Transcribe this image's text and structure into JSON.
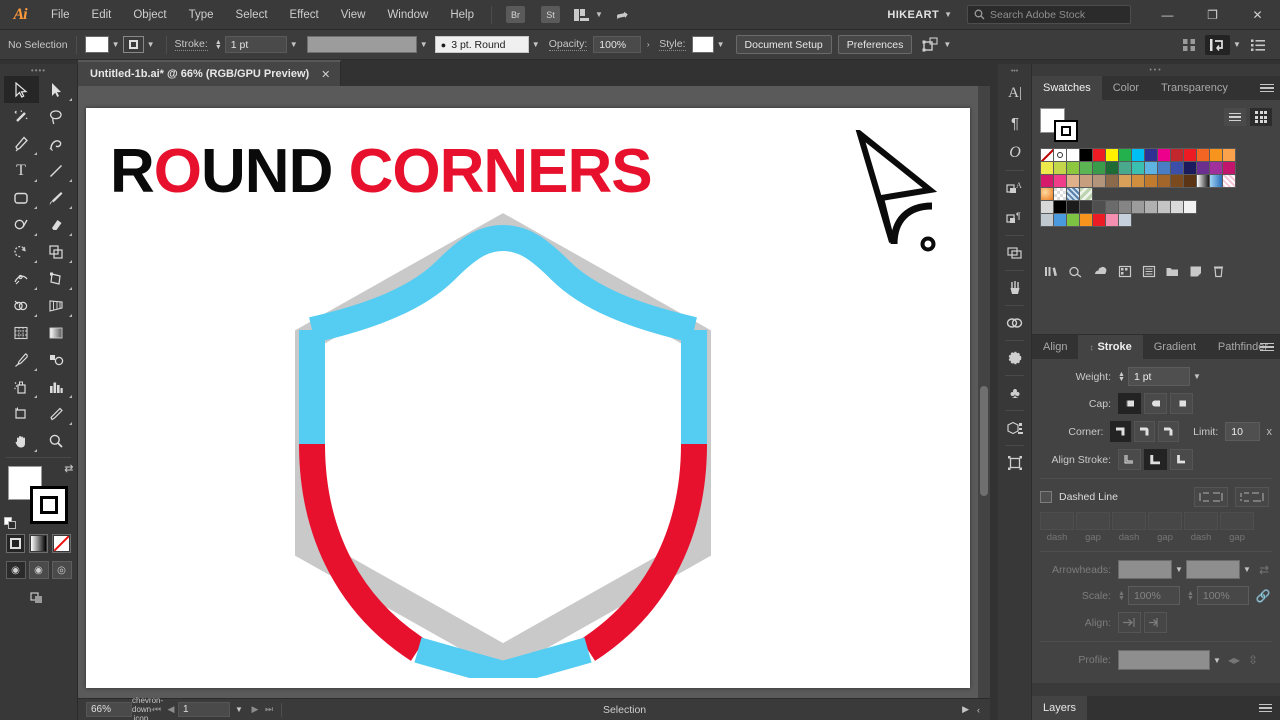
{
  "app": {
    "logo": "Ai",
    "user": "HIKEART"
  },
  "menubar": {
    "items": [
      "File",
      "Edit",
      "Object",
      "Type",
      "Select",
      "Effect",
      "View",
      "Window",
      "Help"
    ],
    "bridge_label": "Br",
    "stock_label": "St",
    "arrange_icon": "arrange-documents-icon",
    "rocket_icon": "rocket-icon",
    "user_chevron": "chevron-down-icon",
    "search_placeholder": "Search Adobe Stock",
    "search_icon": "search-icon",
    "window_buttons": {
      "minimize": "—",
      "maximize": "❐",
      "close": "✕"
    }
  },
  "controlbar": {
    "selection_status": "No Selection",
    "fill_color": "#ffffff",
    "stroke_color": "#ffffff",
    "stroke_label": "Stroke:",
    "stroke_weight": "1 pt",
    "brush_definition": "3 pt. Round",
    "opacity_label": "Opacity:",
    "opacity_value": "100%",
    "opacity_more": "›",
    "style_label": "Style:",
    "document_setup": "Document Setup",
    "preferences": "Preferences",
    "align_icon": "align-objects-icon",
    "transform_icon": "transform-icon",
    "arrange_icon": "arrange-icon",
    "options_icon": "panel-options-icon"
  },
  "tab": {
    "title": "Untitled-1b.ai* @ 66% (RGB/GPU Preview)",
    "close": "✕"
  },
  "toolbar": {
    "tools": [
      {
        "name": "selection-tool",
        "glyph": "selection",
        "active": true
      },
      {
        "name": "direct-selection-tool",
        "glyph": "direct-selection",
        "active": false
      },
      {
        "name": "magic-wand-tool",
        "glyph": "magic-wand",
        "active": false
      },
      {
        "name": "lasso-tool",
        "glyph": "lasso",
        "active": false
      },
      {
        "name": "pen-tool",
        "glyph": "pen",
        "active": false
      },
      {
        "name": "curvature-tool",
        "glyph": "curvature",
        "active": false
      },
      {
        "name": "type-tool",
        "glyph": "type",
        "active": false
      },
      {
        "name": "line-segment-tool",
        "glyph": "line",
        "active": false
      },
      {
        "name": "rectangle-tool",
        "glyph": "rectangle",
        "active": false
      },
      {
        "name": "paintbrush-tool",
        "glyph": "paintbrush",
        "active": false
      },
      {
        "name": "shaper-tool",
        "glyph": "shaper",
        "active": false
      },
      {
        "name": "eraser-tool",
        "glyph": "eraser",
        "active": false
      },
      {
        "name": "rotate-tool",
        "glyph": "rotate",
        "active": false
      },
      {
        "name": "scale-tool",
        "glyph": "scale",
        "active": false
      },
      {
        "name": "width-tool",
        "glyph": "width",
        "active": false
      },
      {
        "name": "free-transform-tool",
        "glyph": "free-transform",
        "active": false
      },
      {
        "name": "shape-builder-tool",
        "glyph": "shape-builder",
        "active": false
      },
      {
        "name": "perspective-grid-tool",
        "glyph": "perspective",
        "active": false
      },
      {
        "name": "mesh-tool",
        "glyph": "mesh",
        "active": false
      },
      {
        "name": "gradient-tool",
        "glyph": "gradient",
        "active": false
      },
      {
        "name": "eyedropper-tool",
        "glyph": "eyedropper",
        "active": false
      },
      {
        "name": "blend-tool",
        "glyph": "blend",
        "active": false
      },
      {
        "name": "symbol-sprayer-tool",
        "glyph": "symbol-sprayer",
        "active": false
      },
      {
        "name": "column-graph-tool",
        "glyph": "column-graph",
        "active": false
      },
      {
        "name": "artboard-tool",
        "glyph": "artboard",
        "active": false
      },
      {
        "name": "slice-tool",
        "glyph": "slice",
        "active": false
      },
      {
        "name": "hand-tool",
        "glyph": "hand",
        "active": false
      },
      {
        "name": "zoom-tool",
        "glyph": "zoom",
        "active": false
      }
    ],
    "fill_color": "#ffffff",
    "stroke_color": "#000000",
    "swap_icon": "swap-fill-stroke-icon",
    "default_icon": "default-fill-stroke-icon",
    "modes": [
      "color-mode",
      "gradient-mode",
      "none-mode"
    ],
    "screen_modes": [
      "normal-screen-mode",
      "full-screen-menu-mode",
      "full-screen-mode"
    ]
  },
  "artwork": {
    "title_parts": [
      {
        "text": "R",
        "color": "#0a0a0a"
      },
      {
        "text": "O",
        "color": "#e8112d"
      },
      {
        "text": "UND",
        "color": "#0a0a0a"
      },
      {
        "text": " ",
        "color": "#0a0a0a"
      },
      {
        "text": "CORNERS",
        "color": "#e8112d"
      }
    ],
    "shield": {
      "hexagon_color": "#c9c9c9",
      "cyan_color": "#55ccf2",
      "red_color": "#e8112d",
      "description": "shield-outline-over-hexagon"
    },
    "corner_widget": "live-corner-widget-icon"
  },
  "statusbar": {
    "zoom": "66%",
    "zoom_chevron": "chevron-down-icon",
    "artboard_number": "1",
    "artboard_chevron": "chevron-down-icon",
    "nav_first": "❘◀",
    "nav_prev": "◀",
    "nav_next": "▶",
    "nav_last": "▶❘",
    "status_text": "Selection",
    "play_icon": "▶",
    "resize_icon": "‹"
  },
  "icondock": {
    "icons": [
      {
        "name": "character-panel-icon",
        "glyph": "A"
      },
      {
        "name": "paragraph-panel-icon",
        "glyph": "¶"
      },
      {
        "name": "opentype-panel-icon",
        "glyph": "O"
      },
      {
        "name": "appearance-panel-icon",
        "glyph": "❑A"
      },
      {
        "name": "graphic-styles-panel-icon",
        "glyph": "❑¶"
      },
      {
        "name": "layers-panel-icon",
        "glyph": "❐"
      },
      {
        "name": "brushes-panel-icon",
        "glyph": "brush"
      },
      {
        "name": "libraries-panel-icon",
        "glyph": "∞"
      },
      {
        "name": "image-trace-panel-icon",
        "glyph": "◌"
      },
      {
        "name": "symbols-panel-icon",
        "glyph": "♣"
      },
      {
        "name": "asset-export-panel-icon",
        "glyph": "cube"
      },
      {
        "name": "artboards-panel-icon",
        "glyph": "⬚"
      }
    ]
  },
  "swatches": {
    "tabs": [
      {
        "label": "Swatches",
        "active": true
      },
      {
        "label": "Color",
        "active": false
      },
      {
        "label": "Transparency",
        "active": false
      }
    ],
    "menu_icon": "panel-menu-icon",
    "view_list_icon": "list-view-icon",
    "view_grid_icon": "grid-view-icon",
    "fill_color": "#ffffff",
    "stroke_color": "#000000",
    "colors": [
      [
        "none",
        "registration",
        "#ffffff",
        "#000000",
        "#ed1c24",
        "#fff200",
        "#22b14c",
        "#00c0f3",
        "#2e3192",
        "#ec008c",
        "#c1272d",
        "#ed1c24",
        "#f26522",
        "#f7941d",
        "#f9a14b"
      ],
      [
        "#eeea4c",
        "#c4d64a",
        "#8dc63f",
        "#5ab552",
        "#3a9c4b",
        "#1e6b36",
        "#4aa88c",
        "#3bbfb0",
        "#5fb3e0",
        "#4a7ec4",
        "#3b4ea8",
        "#1b1b5e",
        "#6b2f8f",
        "#a0309b",
        "#c2156e"
      ],
      [
        "#d5196b",
        "#ef3d8a",
        "#e0b08a",
        "#c89f7e",
        "#b2957b",
        "#8a6a4a",
        "#d9a05a",
        "#cf8f3f",
        "#c07b2e",
        "#a2662a",
        "#7b4a1e",
        "#5a3415",
        "gradient-bw",
        "gradient-blue",
        "pattern-pink"
      ],
      [
        "gradient-orange",
        "pattern-checker",
        "pattern-texture",
        "pattern-leaves"
      ],
      [
        "#d8d8d8",
        "#000000",
        "#1c1c1c",
        "#353535",
        "#4f4f4f",
        "#6b6b6b",
        "#858585",
        "#9c9c9c",
        "#b0b0b0",
        "#c4c4c4",
        "#dadada",
        "#f2f2f2"
      ],
      [
        "#c0c8d0",
        "#4a9ae0",
        "#7dc242",
        "#f7941d",
        "#ed1c24",
        "#f48fb1",
        "#c5d0dc"
      ]
    ],
    "footer_icons": [
      "swatch-libraries-icon",
      "show-swatch-kinds-icon",
      "color-group-icon",
      "color-guide-icon",
      "swatch-options-icon",
      "new-color-group-icon",
      "new-swatch-icon",
      "delete-swatch-icon"
    ]
  },
  "stroke_panel": {
    "tabs": [
      {
        "label": "Align",
        "active": false
      },
      {
        "label": "Stroke",
        "active": true
      },
      {
        "label": "Gradient",
        "active": false
      },
      {
        "label": "Pathfinder",
        "active": false
      }
    ],
    "menu_icon": "panel-menu-icon",
    "weight_label": "Weight:",
    "weight_value": "1 pt",
    "cap_label": "Cap:",
    "cap_options": [
      "butt-cap",
      "round-cap",
      "projecting-cap"
    ],
    "cap_selected": 0,
    "corner_label": "Corner:",
    "corner_options": [
      "miter-join",
      "round-join",
      "bevel-join"
    ],
    "corner_selected": 0,
    "limit_label": "Limit:",
    "limit_value": "10",
    "limit_unit": "x",
    "align_stroke_label": "Align Stroke:",
    "align_options": [
      "align-center",
      "align-inside",
      "align-outside"
    ],
    "align_selected": 1,
    "dashed_line_label": "Dashed Line",
    "dash_checked": false,
    "dash_preserve_icon": "preserve-dash-exact-icon",
    "dash_adjust_icon": "adjust-dashes-to-corners-icon",
    "dash_labels": [
      "dash",
      "gap",
      "dash",
      "gap",
      "dash",
      "gap"
    ],
    "arrowheads_label": "Arrowheads:",
    "arrow_swap_icon": "swap-arrowheads-icon",
    "scale_label": "Scale:",
    "scale_start": "100%",
    "scale_end": "100%",
    "scale_link_icon": "link-scale-icon",
    "align_label": "Align:",
    "align_arrow_icons": [
      "extend-arrow-beyond-end-icon",
      "place-arrow-at-end-icon"
    ],
    "profile_label": "Profile:",
    "profile_flip_x_icon": "flip-profile-across-icon",
    "profile_flip_y_icon": "flip-profile-along-icon"
  },
  "layers_panel": {
    "tab_label": "Layers",
    "menu_icon": "panel-menu-icon"
  }
}
